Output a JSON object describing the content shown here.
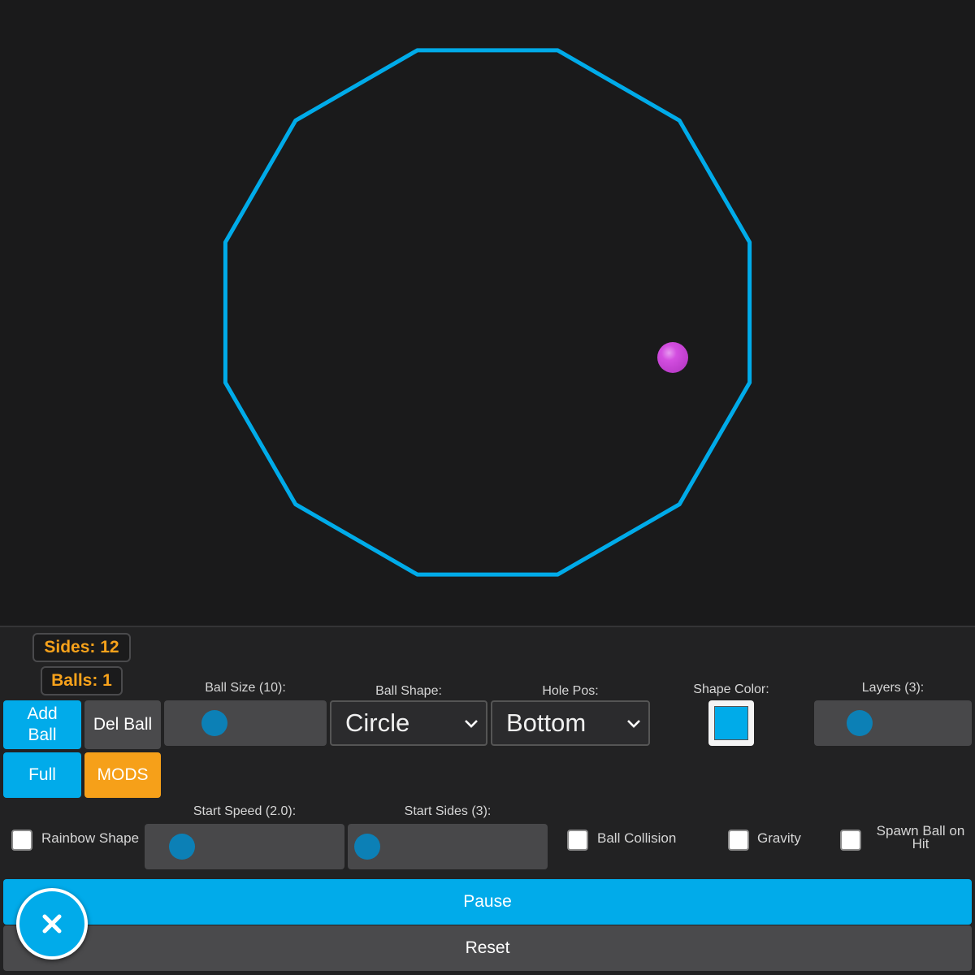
{
  "colors": {
    "shape": "#00abe9",
    "ball": "#d34ee0",
    "accent": "#01abea",
    "orange": "#f6a019",
    "counter_text": "#f7a21b",
    "background": "#1a1a1b"
  },
  "scene": {
    "sides": 12,
    "ball_count": 1
  },
  "counters": {
    "sides": "Sides: 12",
    "balls": "Balls: 1"
  },
  "buttons": {
    "add_ball": "Add Ball",
    "del_ball": "Del Ball",
    "full": "Full",
    "mods": "MODS",
    "pause": "Pause",
    "reset": "Reset",
    "close_icon": "close-icon"
  },
  "sliders": {
    "ball_size": {
      "label": "Ball Size (10):",
      "value": 10
    },
    "layers": {
      "label": "Layers (3):",
      "value": 3
    },
    "start_speed": {
      "label": "Start Speed (2.0):",
      "value": 2.0
    },
    "start_sides": {
      "label": "Start Sides (3):",
      "value": 3
    }
  },
  "selects": {
    "ball_shape": {
      "label": "Ball Shape:",
      "value": "Circle"
    },
    "hole_pos": {
      "label": "Hole Pos:",
      "value": "Bottom"
    }
  },
  "shape_color": {
    "label": "Shape Color:",
    "value": "#00abe9"
  },
  "checkboxes": {
    "rainbow_shape": {
      "label": "Rainbow Shape",
      "checked": false
    },
    "ball_collision": {
      "label": "Ball Collision",
      "checked": false
    },
    "gravity": {
      "label": "Gravity",
      "checked": false
    },
    "spawn_ball_on_hit": {
      "label": "Spawn Ball on Hit",
      "checked": false
    }
  }
}
